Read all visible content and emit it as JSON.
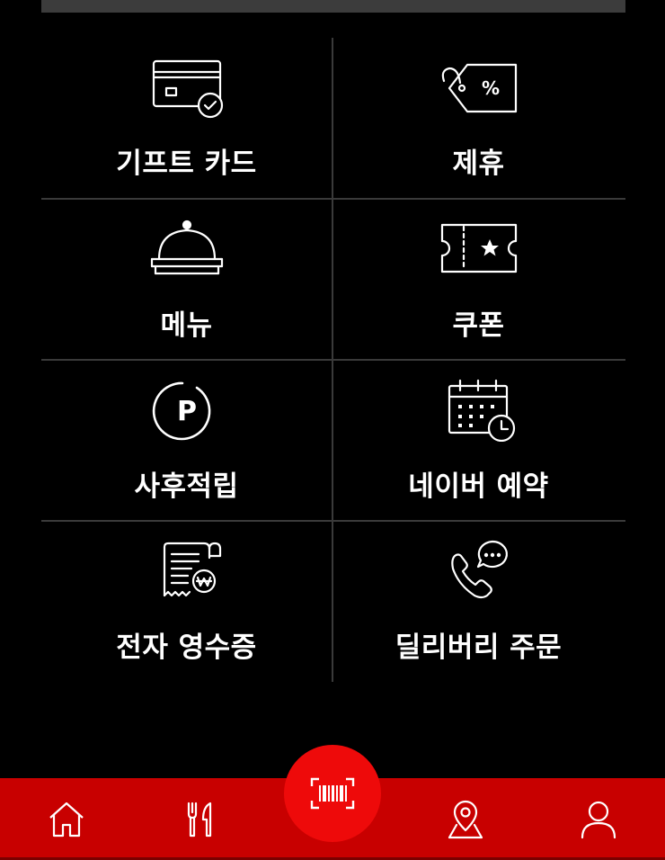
{
  "menu": {
    "items": [
      {
        "label": "기프트 카드",
        "icon": "gift-card-icon"
      },
      {
        "label": "제휴",
        "icon": "discount-tag-icon"
      },
      {
        "label": "메뉴",
        "icon": "food-cloche-icon"
      },
      {
        "label": "쿠폰",
        "icon": "coupon-ticket-icon"
      },
      {
        "label": "사후적립",
        "icon": "points-icon"
      },
      {
        "label": "네이버 예약",
        "icon": "calendar-clock-icon"
      },
      {
        "label": "전자 영수증",
        "icon": "receipt-icon"
      },
      {
        "label": "딜리버리 주문",
        "icon": "phone-chat-icon"
      }
    ]
  },
  "tag_symbol": "%",
  "points_symbol": "P",
  "nav": {
    "items": [
      {
        "icon": "home-icon"
      },
      {
        "icon": "fork-knife-icon"
      },
      {
        "icon": "barcode-scan-icon"
      },
      {
        "icon": "location-pin-icon"
      },
      {
        "icon": "user-icon"
      }
    ]
  },
  "colors": {
    "background": "#000000",
    "nav_bar": "#c80000",
    "scan_button": "#ee0a0a",
    "divider": "#3a3a3a",
    "text": "#ffffff"
  }
}
